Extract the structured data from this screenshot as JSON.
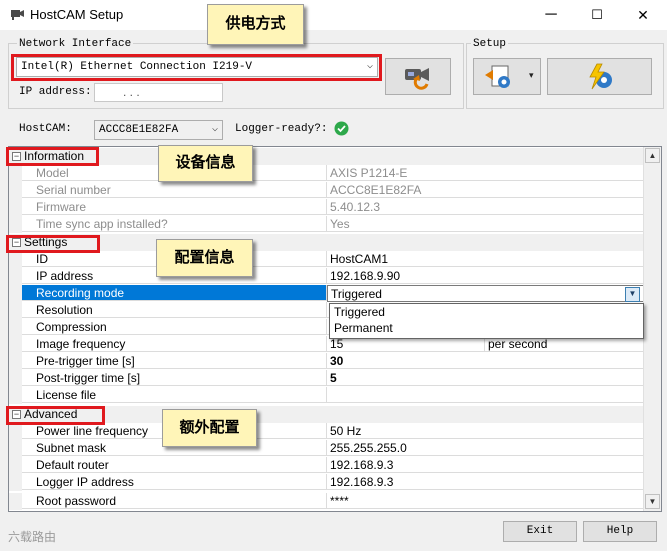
{
  "window": {
    "title": "HostCAM Setup",
    "min": "─",
    "max": "☐",
    "close": "✕"
  },
  "network": {
    "group_label": "Network Interface",
    "interface": "Intel(R) Ethernet Connection I219-V",
    "ip_label": "IP address:",
    "ip_value": ".      .      ."
  },
  "setup": {
    "group_label": "Setup"
  },
  "hostcam": {
    "label": "HostCAM:",
    "value": "ACCC8E1E82FA",
    "logger_label": "Logger-ready?:"
  },
  "callouts": {
    "power": "供电方式",
    "device": "设备信息",
    "config": "配置信息",
    "extra": "额外配置"
  },
  "grid": {
    "information": {
      "label": "Information",
      "rows": [
        {
          "name": "Model",
          "value": "AXIS P1214-E"
        },
        {
          "name": "Serial number",
          "value": "ACCC8E1E82FA"
        },
        {
          "name": "Firmware",
          "value": "5.40.12.3"
        },
        {
          "name": "Time sync app installed?",
          "value": "Yes"
        }
      ]
    },
    "settings": {
      "label": "Settings",
      "rows": [
        {
          "name": "ID",
          "value": "HostCAM1"
        },
        {
          "name": "IP address",
          "value": "192.168.9.90"
        },
        {
          "name": "Recording mode",
          "value": "Triggered"
        },
        {
          "name": "Resolution",
          "value": ""
        },
        {
          "name": "Compression",
          "value": ""
        },
        {
          "name": "Image frequency",
          "value": "15",
          "unit": "per second"
        },
        {
          "name": "Pre-trigger time [s]",
          "value": "30"
        },
        {
          "name": "Post-trigger time [s]",
          "value": "5"
        },
        {
          "name": "License file",
          "value": ""
        }
      ]
    },
    "advanced": {
      "label": "Advanced",
      "rows": [
        {
          "name": "Power line frequency",
          "value": "50 Hz"
        },
        {
          "name": "Subnet mask",
          "value": "255.255.255.0"
        },
        {
          "name": "Default router",
          "value": "192.168.9.3"
        },
        {
          "name": "Logger IP address",
          "value": "192.168.9.3"
        },
        {
          "name": "Root password",
          "value": "****"
        }
      ]
    }
  },
  "dropdown": {
    "options": [
      "Triggered",
      "Permanent"
    ]
  },
  "footer": {
    "exit": "Exit",
    "help": "Help",
    "watermark": "六载路由"
  }
}
